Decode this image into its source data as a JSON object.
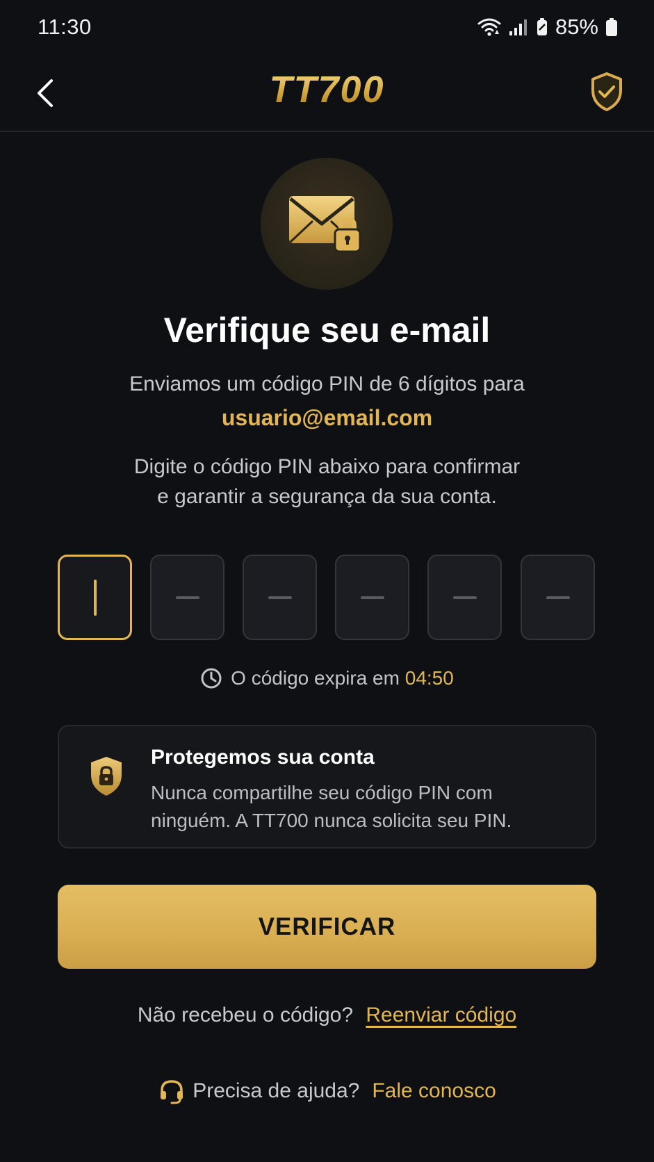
{
  "status_bar": {
    "time": "11:30",
    "battery": "85%",
    "icons": [
      "wifi-icon",
      "signal-icon",
      "battery-saver-icon",
      "battery-icon"
    ]
  },
  "header": {
    "logo": "TT700",
    "back_icon": "chevron-left-icon",
    "security_icon": "shield-check-icon"
  },
  "hero": {
    "icon": "mail-lock-icon"
  },
  "title": "Verifique seu e-mail",
  "subtitle": "Enviamos um código PIN de 6 dígitos para",
  "email": "usuario@email.com",
  "instruction": {
    "line1": "Digite o código PIN abaixo para confirmar",
    "line2": "e garantir a segurança da sua conta."
  },
  "pin": {
    "length": 6,
    "active_index": 0,
    "digits": [
      "",
      "",
      "",
      "",
      "",
      ""
    ]
  },
  "timer": {
    "label": "O código expira em",
    "value": "04:50",
    "icon": "clock-icon"
  },
  "info": {
    "icon": "shield-lock-icon",
    "title": "Protegemos sua conta",
    "line1": "Nunca compartilhe seu código PIN com",
    "line2": "ninguém. A TT700 nunca solicita seu PIN."
  },
  "verify_button": "VERIFICAR",
  "resend": {
    "question": "Não recebeu o código?",
    "link": "Reenviar código"
  },
  "help": {
    "icon": "headset-icon",
    "question": "Precisa de ajuda?",
    "link": "Fale conosco"
  },
  "colors": {
    "background": "#0f1014",
    "accent": "#e2b652",
    "button": "#dcb258",
    "card": "#16171b"
  }
}
